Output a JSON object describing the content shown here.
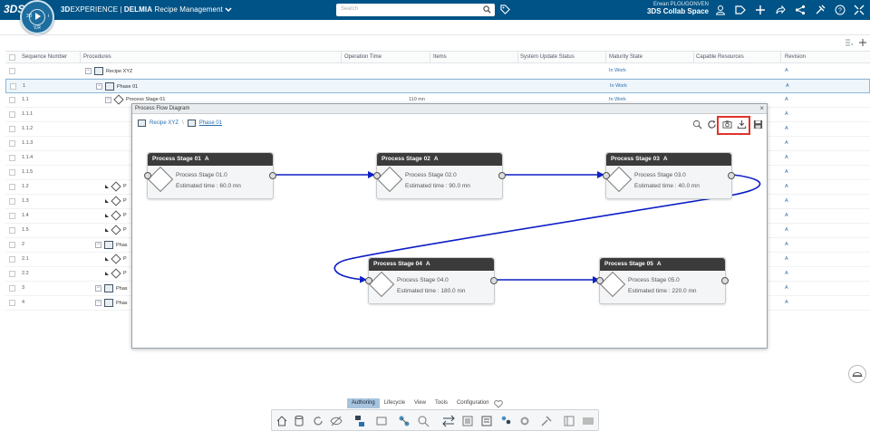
{
  "colors": {
    "topbar": "#005386",
    "link": "#2a6fb0",
    "flow": "#0d1fc5",
    "node_header": "#3b3b3b",
    "highlight": "#e0332a"
  },
  "topbar": {
    "ds_logo": "3DS",
    "compass_top": "",
    "compass_v": "3D",
    "compass_r": "i",
    "compass_bottom": "V,R",
    "brand_prefix": "3D",
    "brand_experience": "EXPERIENCE",
    "brand_sep": " | ",
    "brand_app": "DELMIA",
    "brand_module": "Recipe Management",
    "search_placeholder": "Search",
    "user_name": "Erwan PLOUGONVEN",
    "user_space": "3DS Collab Space",
    "icons": [
      "search-icon",
      "tag-icon",
      "user-icon",
      "tag-outline-icon",
      "plus-icon",
      "share-arrow-icon",
      "share-network-icon",
      "tools-icon",
      "help-icon",
      "compass-icon"
    ]
  },
  "table": {
    "columns": [
      "Sequence Number",
      "Procedures",
      "Operation Time",
      "Items",
      "System Update Status",
      "Maturity State",
      "Capable Resources",
      "Revision"
    ],
    "rows": [
      {
        "seq": "",
        "label": "Recipe XYZ",
        "kind": "recipe",
        "indent": 0,
        "state": "In Work",
        "rev": "A",
        "optime": ""
      },
      {
        "seq": "1",
        "label": "Phase 01",
        "kind": "phase",
        "indent": 1,
        "state": "In Work",
        "rev": "A",
        "optime": "",
        "selected": true
      },
      {
        "seq": "1.1",
        "label": "Process Stage 01",
        "kind": "stage",
        "indent": 2,
        "state": "In Work",
        "rev": "A",
        "optime": "110 mn"
      },
      {
        "seq": "1.1.1",
        "label": "",
        "kind": "sub",
        "indent": 3,
        "state": "",
        "rev": "A",
        "optime": ""
      },
      {
        "seq": "1.1.2",
        "label": "",
        "kind": "sub",
        "indent": 3,
        "state": "",
        "rev": "A",
        "optime": ""
      },
      {
        "seq": "1.1.3",
        "label": "",
        "kind": "sub",
        "indent": 3,
        "state": "",
        "rev": "A",
        "optime": ""
      },
      {
        "seq": "1.1.4",
        "label": "",
        "kind": "sub",
        "indent": 3,
        "state": "",
        "rev": "A",
        "optime": ""
      },
      {
        "seq": "1.1.5",
        "label": "",
        "kind": "sub",
        "indent": 3,
        "state": "",
        "rev": "A",
        "optime": ""
      },
      {
        "seq": "1.2",
        "label": "P",
        "kind": "stage2",
        "indent": 2,
        "state": "",
        "rev": "A",
        "optime": ""
      },
      {
        "seq": "1.3",
        "label": "P",
        "kind": "stage2",
        "indent": 2,
        "state": "",
        "rev": "A",
        "optime": ""
      },
      {
        "seq": "1.4",
        "label": "P",
        "kind": "stage2",
        "indent": 2,
        "state": "",
        "rev": "A",
        "optime": ""
      },
      {
        "seq": "1.5",
        "label": "P",
        "kind": "stage2",
        "indent": 2,
        "state": "",
        "rev": "A",
        "optime": ""
      },
      {
        "seq": "2",
        "label": "Phas",
        "kind": "phase",
        "indent": 1,
        "state": "",
        "rev": "A",
        "optime": ""
      },
      {
        "seq": "2.1",
        "label": "P",
        "kind": "stage2",
        "indent": 2,
        "state": "",
        "rev": "A",
        "optime": ""
      },
      {
        "seq": "2.2",
        "label": "P",
        "kind": "stage2",
        "indent": 2,
        "state": "",
        "rev": "A",
        "optime": ""
      },
      {
        "seq": "3",
        "label": "Phas",
        "kind": "phase",
        "indent": 1,
        "state": "",
        "rev": "A",
        "optime": ""
      },
      {
        "seq": "4",
        "label": "Phas",
        "kind": "phase",
        "indent": 1,
        "state": "",
        "rev": "A",
        "optime": ""
      }
    ]
  },
  "dialog": {
    "title": "Process Flow Diagram",
    "close": "×",
    "breadcrumb_root": "Recipe XYZ",
    "breadcrumb_sep": "\\",
    "breadcrumb_current": "Phase 01",
    "tools": [
      "zoom-icon",
      "refresh-icon",
      "snapshot-icon",
      "download-icon",
      "save-icon"
    ],
    "nodes": [
      {
        "title": "Process Stage 01",
        "rev": "A",
        "name": "Process Stage 01.0",
        "time": "Estimated time : 60.0 mn"
      },
      {
        "title": "Process Stage 02",
        "rev": "A",
        "name": "Process Stage 02.0",
        "time": "Estimated time : 90.0 mn"
      },
      {
        "title": "Process Stage 03",
        "rev": "A",
        "name": "Process Stage 03.0",
        "time": "Estimated time : 40.0 mn"
      },
      {
        "title": "Process Stage 04",
        "rev": "A",
        "name": "Process Stage 04.0",
        "time": "Estimated time : 180.0 mn"
      },
      {
        "title": "Process Stage 05",
        "rev": "A",
        "name": "Process Stage 05.0",
        "time": "Estimated time : 220.0 mn"
      }
    ]
  },
  "bottom": {
    "tabs": [
      "Authoring",
      "Lifecycle",
      "View",
      "Tools",
      "Configuration"
    ],
    "active_tab": "Authoring"
  }
}
